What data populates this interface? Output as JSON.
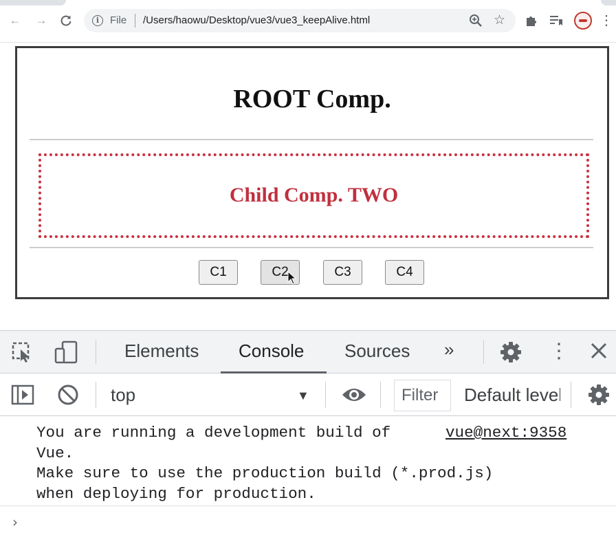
{
  "browser": {
    "scheme_label": "File",
    "url": "/Users/haowu/Desktop/vue3/vue3_keepAlive.html"
  },
  "page": {
    "root_title": "ROOT Comp.",
    "child_title": "Child Comp. TWO",
    "buttons": [
      {
        "label": "C1"
      },
      {
        "label": "C2",
        "active": true
      },
      {
        "label": "C3"
      },
      {
        "label": "C4"
      }
    ]
  },
  "devtools": {
    "tabs": [
      {
        "label": "Elements"
      },
      {
        "label": "Console",
        "selected": true
      },
      {
        "label": "Sources"
      }
    ],
    "overflow_label": "»",
    "context": "top",
    "filter_placeholder": "Filter",
    "levels_label": "Default levels",
    "console": {
      "line1": "You are running a development build of",
      "source_link": "vue@next:9358",
      "line2": "Vue.",
      "line3": "Make sure to use the production build (*.prod.js)",
      "line4": "when deploying for production."
    }
  },
  "colors": {
    "child_accent": "#c9303d",
    "root_border": "#3c3c3c"
  }
}
